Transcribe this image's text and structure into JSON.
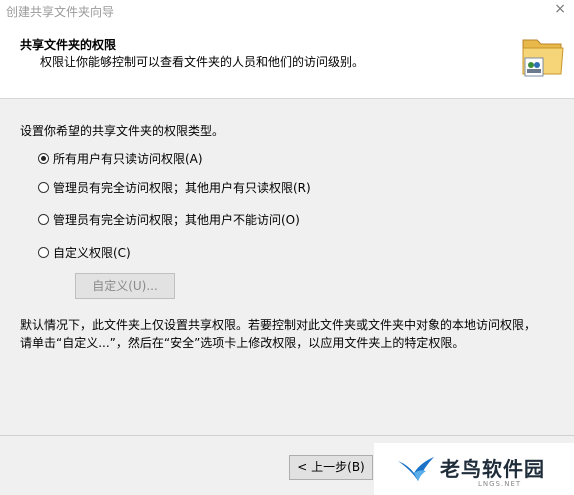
{
  "window": {
    "title": "创建共享文件夹向导",
    "close_label": "×"
  },
  "header": {
    "title": "共享文件夹的权限",
    "subtitle": "权限让你能够控制可以查看文件夹的人员和他们的访问级别。",
    "icon": "shared-folder-icon"
  },
  "main": {
    "intro": "设置你希望的共享文件夹的权限类型。",
    "options": [
      {
        "label": "所有用户有只读访问权限(A)",
        "selected": true
      },
      {
        "label": "管理员有完全访问权限；其他用户有只读权限(R)",
        "selected": false
      },
      {
        "label": "管理员有完全访问权限；其他用户不能访问(O)",
        "selected": false
      },
      {
        "label": "自定义权限(C)",
        "selected": false
      }
    ],
    "custom_button": "自定义(U)...",
    "note": "默认情况下，此文件夹上仅设置共享权限。若要控制对此文件夹或文件夹中对象的本地访问权限，请单击“自定义...”，然后在“安全”选项卡上修改权限，以应用文件夹上的特定权限。"
  },
  "footer": {
    "back_button": "< 上一步(B)"
  },
  "watermark": {
    "text": "老鸟软件园",
    "sub": "LNGS.NET"
  }
}
